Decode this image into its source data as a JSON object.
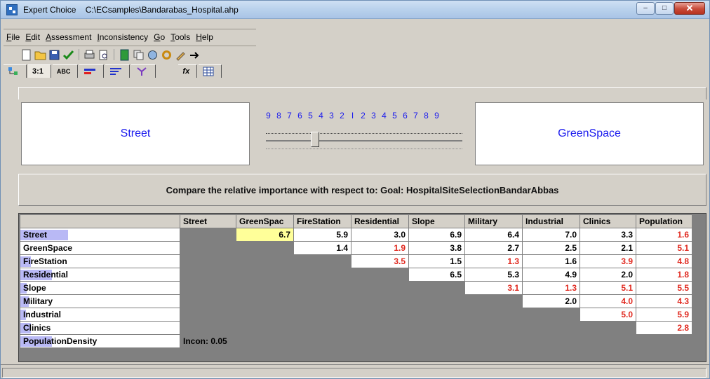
{
  "window": {
    "app_name": "Expert Choice",
    "file_path": "C:\\ECsamples\\Bandarabas_Hospital.ahp"
  },
  "menu": [
    "File",
    "Edit",
    "Assessment",
    "Inconsistency",
    "Go",
    "Tools",
    "Help"
  ],
  "toolbar_icons": [
    "new-file-icon",
    "open-folder-icon",
    "save-icon",
    "check-icon",
    "print-icon",
    "print-preview-icon",
    "calculator-icon",
    "copy-icon",
    "globe-icon",
    "refresh-icon",
    "pencil-icon",
    "arrow-icon"
  ],
  "tabs": [
    {
      "label": "",
      "icon": "tree-icon"
    },
    {
      "label": "3:1",
      "icon": ""
    },
    {
      "label": "ABC",
      "icon": ""
    },
    {
      "label": "",
      "icon": "bar-red-icon"
    },
    {
      "label": "",
      "icon": "bar-blue-icon"
    },
    {
      "label": "",
      "icon": "branch-icon"
    },
    {
      "label": "fx",
      "icon": ""
    },
    {
      "label": "",
      "icon": "grid-icon"
    }
  ],
  "comparison": {
    "left": "Street",
    "right": "GreenSpace",
    "scale": [
      "9",
      "8",
      "7",
      "6",
      "5",
      "4",
      "3",
      "2",
      "1",
      "2",
      "3",
      "4",
      "5",
      "6",
      "7",
      "8",
      "9"
    ],
    "slider_value": "7",
    "prompt": "Compare the relative importance with respect to: Goal: HospitalSiteSelectionBandarAbbas"
  },
  "matrix": {
    "columns": [
      "Street",
      "GreenSpac",
      "FireStation",
      "Residential",
      "Slope",
      "Military",
      "Industrial",
      "Clinics",
      "Population"
    ],
    "rows": [
      {
        "label": "Street",
        "bold_chars": "Street",
        "weight": 0.45,
        "cells": [
          "",
          "6.7",
          "5.9",
          "3.0",
          "6.9",
          "6.4",
          "7.0",
          "3.3",
          "1.6"
        ],
        "colors": [
          "",
          "black",
          "black",
          "black",
          "black",
          "black",
          "black",
          "black",
          "red"
        ]
      },
      {
        "label": "GreenSpace",
        "weight": 0.0,
        "cells": [
          "",
          "",
          "1.4",
          "1.9",
          "3.8",
          "2.7",
          "2.5",
          "2.1",
          "5.1"
        ],
        "colors": [
          "",
          "",
          "black",
          "red",
          "black",
          "black",
          "black",
          "black",
          "red"
        ]
      },
      {
        "label": "FireStation",
        "weight": 0.1,
        "cells": [
          "",
          "",
          "",
          "3.5",
          "1.5",
          "1.3",
          "1.6",
          "3.9",
          "4.8"
        ],
        "colors": [
          "",
          "",
          "",
          "red",
          "black",
          "red",
          "black",
          "red",
          "red"
        ]
      },
      {
        "label": "Residential",
        "weight": 0.3,
        "cells": [
          "",
          "",
          "",
          "",
          "6.5",
          "5.3",
          "4.9",
          "2.0",
          "1.8"
        ],
        "colors": [
          "",
          "",
          "",
          "",
          "black",
          "black",
          "black",
          "black",
          "red"
        ]
      },
      {
        "label": "Slope",
        "weight": 0.06,
        "cells": [
          "",
          "",
          "",
          "",
          "",
          "3.1",
          "1.3",
          "5.1",
          "5.5"
        ],
        "colors": [
          "",
          "",
          "",
          "",
          "",
          "red",
          "red",
          "red",
          "red"
        ]
      },
      {
        "label": "Military",
        "weight": 0.08,
        "cells": [
          "",
          "",
          "",
          "",
          "",
          "",
          "2.0",
          "4.0",
          "4.3"
        ],
        "colors": [
          "",
          "",
          "",
          "",
          "",
          "",
          "black",
          "red",
          "red"
        ]
      },
      {
        "label": "Industrial",
        "weight": 0.05,
        "cells": [
          "",
          "",
          "",
          "",
          "",
          "",
          "",
          "5.0",
          "5.9"
        ],
        "colors": [
          "",
          "",
          "",
          "",
          "",
          "",
          "",
          "red",
          "red"
        ]
      },
      {
        "label": "Clinics",
        "weight": 0.1,
        "cells": [
          "",
          "",
          "",
          "",
          "",
          "",
          "",
          "",
          "2.8"
        ],
        "colors": [
          "",
          "",
          "",
          "",
          "",
          "",
          "",
          "",
          "red"
        ]
      },
      {
        "label": "PopulationDensity",
        "weight": 0.3,
        "cells": [
          "",
          "",
          "",
          "",
          "",
          "",
          "",
          "",
          ""
        ],
        "colors": [
          "",
          "",
          "",
          "",
          "",
          "",
          "",
          "",
          ""
        ]
      }
    ],
    "inconsistency": "Incon: 0.05"
  }
}
